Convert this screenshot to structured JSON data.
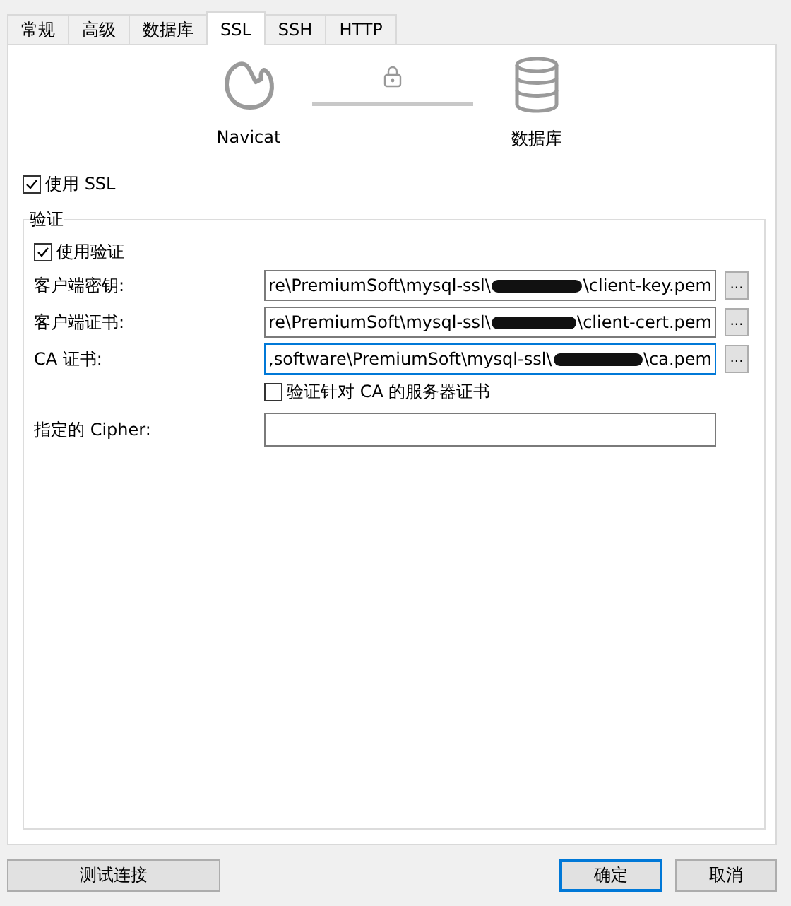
{
  "tabs": [
    {
      "label": "常规",
      "selected": false
    },
    {
      "label": "高级",
      "selected": false
    },
    {
      "label": "数据库",
      "selected": false
    },
    {
      "label": "SSL",
      "selected": true
    },
    {
      "label": "SSH",
      "selected": false
    },
    {
      "label": "HTTP",
      "selected": false
    }
  ],
  "diagram": {
    "client_label": "Navicat",
    "server_label": "数据库"
  },
  "use_ssl": {
    "label": "使用 SSL",
    "checked": true
  },
  "group": {
    "title": "验证",
    "use_auth": {
      "label": "使用验证",
      "checked": true
    },
    "files": [
      {
        "label": "客户端密钥:",
        "value_start": "re\\PremiumSoft\\mysql-ssl\\",
        "redacted": true,
        "value_end": "\\client-key.pem",
        "focused": false,
        "browse": "..."
      },
      {
        "label": "客户端证书:",
        "value_start": "re\\PremiumSoft\\mysql-ssl\\",
        "redacted": true,
        "value_end": "\\client-cert.pem",
        "focused": false,
        "browse": "..."
      },
      {
        "label": "CA 证书:",
        "value_start": ",software\\PremiumSoft\\mysql-ssl\\",
        "redacted": true,
        "value_end": "\\ca.pem",
        "focused": true,
        "browse": "..."
      }
    ],
    "verify_ca": {
      "label": "验证针对 CA 的服务器证书",
      "checked": false
    },
    "cipher": {
      "label": "指定的 Cipher:"
    }
  },
  "buttons": {
    "test": "测试连接",
    "ok": "确定",
    "cancel": "取消"
  }
}
